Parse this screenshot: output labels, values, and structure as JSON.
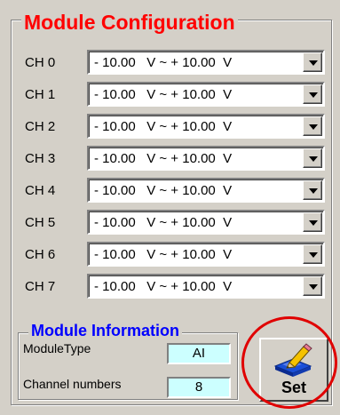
{
  "config": {
    "title": "Module Configuration",
    "channels": [
      {
        "label": "CH 0",
        "range": "- 10.00   V ~ + 10.00  V"
      },
      {
        "label": "CH 1",
        "range": "- 10.00   V ~ + 10.00  V"
      },
      {
        "label": "CH 2",
        "range": "- 10.00   V ~ + 10.00  V"
      },
      {
        "label": "CH 3",
        "range": "- 10.00   V ~ + 10.00  V"
      },
      {
        "label": "CH 4",
        "range": "- 10.00   V ~ + 10.00  V"
      },
      {
        "label": "CH 5",
        "range": "- 10.00   V ~ + 10.00  V"
      },
      {
        "label": "CH 6",
        "range": "- 10.00   V ~ + 10.00  V"
      },
      {
        "label": "CH 7",
        "range": "- 10.00   V ~ + 10.00  V"
      }
    ]
  },
  "info": {
    "title": "Module Information",
    "module_type_label": "ModuleType",
    "module_type_value": "AI",
    "channel_numbers_label": "Channel numbers",
    "channel_numbers_value": "8"
  },
  "set_button": {
    "label": "Set",
    "icon": "edit-pencil-icon"
  },
  "colors": {
    "title_red": "#ff0000",
    "info_title_blue": "#0000ff",
    "value_bg": "#ccffff",
    "highlight": "#e00000"
  }
}
